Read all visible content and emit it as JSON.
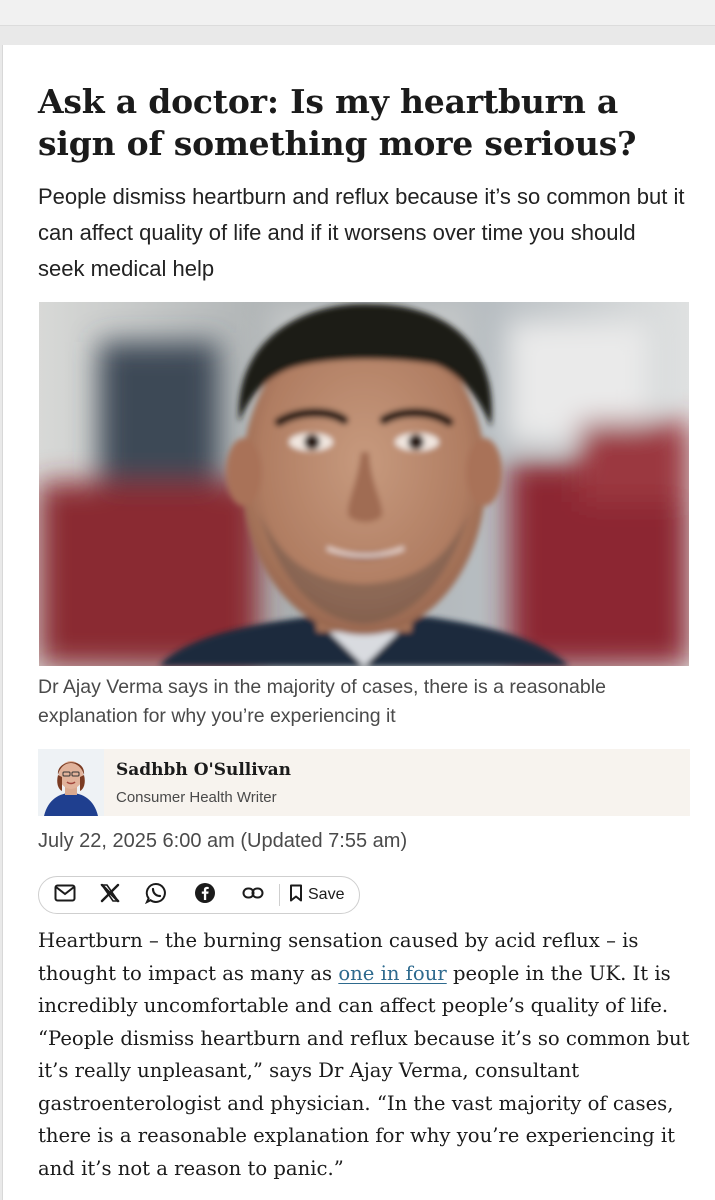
{
  "article": {
    "headline": "Ask a doctor: Is my heartburn a sign of something more serious?",
    "standfirst": "People dismiss heartburn and reflux because it’s so common but it can affect quality of life and if it worsens over time you should seek medical help",
    "image_caption": "Dr Ajay Verma says in the majority of cases, there is a reasonable explanation for why you’re experiencing it",
    "author": {
      "name": "Sadhbh O'Sullivan",
      "role": "Consumer Health Writer"
    },
    "dateline": "July 22, 2025 6:00 am (Updated 7:55 am)",
    "share": {
      "icons": [
        "mail-icon",
        "x-icon",
        "whatsapp-icon",
        "facebook-icon",
        "link-icon",
        "bookmark-icon"
      ],
      "save_label": "Save"
    },
    "body": {
      "part1": "Heartburn – the burning sensation caused by acid reflux – is thought to impact as many as ",
      "link_text": "one in four",
      "part2": " people in the UK. It is incredibly uncomfortable and can affect people’s quality of life. “People dismiss heartburn and reflux because it’s so common but it’s really unpleasant,” says Dr Ajay Verma, consultant gastroenterologist and physician. “In the vast majority of cases, there is a reasonable explanation for why you’re experiencing it and it’s not a reason to panic.”"
    }
  },
  "colors": {
    "link": "#2e6a8e",
    "author_box_bg": "#f7f3ee",
    "caption_text": "#4a4a4a"
  }
}
